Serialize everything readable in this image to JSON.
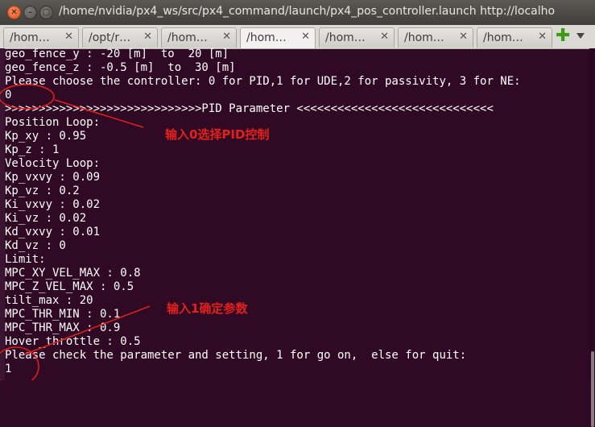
{
  "window": {
    "title": "/home/nvidia/px4_ws/src/px4_command/launch/px4_pos_controller.launch http://localho",
    "close_glyph": "✕",
    "min_glyph": "–",
    "max_glyph": "□"
  },
  "tabs": [
    {
      "label": "/hom…",
      "close": "✕"
    },
    {
      "label": "/opt/r…",
      "close": "✕"
    },
    {
      "label": "/hom…",
      "close": "✕"
    },
    {
      "label": "/hom…",
      "close": "✕",
      "active": true
    },
    {
      "label": "/hom…",
      "close": "✕"
    },
    {
      "label": "/hom…",
      "close": "✕"
    },
    {
      "label": "/hom…",
      "close": "✕"
    }
  ],
  "tabbar": {
    "add_glyph": "✚",
    "menu_icon": "tab-list-icon"
  },
  "terminal": {
    "lines": [
      "geo_fence_y : -20 [m]  to  20 [m]",
      "geo_fence_z : -0.5 [m]  to  30 [m]",
      "Please choose the controller: 0 for PID,1 for UDE,2 for passivity, 3 for NE:",
      "0",
      ">>>>>>>>>>>>>>>>>>>>>>>>>>>>>PID Parameter <<<<<<<<<<<<<<<<<<<<<<<<<<<<<",
      "Position Loop:",
      "Kp_xy : 0.95",
      "Kp_z : 1",
      "Velocity Loop:",
      "Kp_vxvy : 0.09",
      "Kp_vz : 0.2",
      "Ki_vxvy : 0.02",
      "Ki_vz : 0.02",
      "Kd_vxvy : 0.01",
      "Kd_vz : 0",
      "Limit:",
      "MPC_XY_VEL_MAX : 0.8",
      "MPC_Z_VEL_MAX : 0.5",
      "tilt_max : 20",
      "MPC_THR_MIN : 0.1",
      "MPC_THR_MAX : 0.9",
      "Hover_throttle : 0.5",
      "Please check the parameter and setting, 1 for go on,  else for quit:",
      "1"
    ]
  },
  "annotations": {
    "note1": "输入0选择PID控制",
    "note2": "输入1确定参数",
    "color": "#e3201b"
  },
  "colors": {
    "terminal_bg": "#300a24",
    "terminal_fg": "#ffffff"
  }
}
